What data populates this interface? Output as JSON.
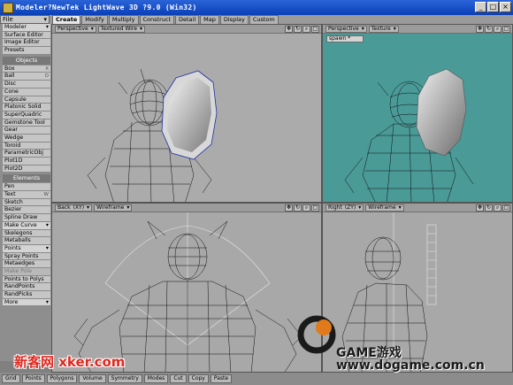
{
  "window": {
    "title": "Modeler?NewTek LightWave 3D ?9.0 (Win32)",
    "buttons": [
      "_",
      "□",
      "×"
    ]
  },
  "toolbar": {
    "file_label": "File",
    "tabs": [
      "Create",
      "Modify",
      "Multiply",
      "Construct",
      "Detail",
      "Map",
      "Display",
      "Custom"
    ],
    "active_tab": "Create"
  },
  "sidebar": {
    "top": [
      {
        "label": "Modeler",
        "dropdown": true
      },
      {
        "label": "Surface Editor",
        "key": ""
      },
      {
        "label": "Image Editor",
        "key": ""
      },
      {
        "label": "Presets",
        "key": ""
      }
    ],
    "objects_header": "Objects",
    "objects": [
      {
        "label": "Box",
        "key": "X"
      },
      {
        "label": "Ball",
        "key": "O"
      },
      {
        "label": "Disc",
        "key": ""
      },
      {
        "label": "Cone",
        "key": ""
      },
      {
        "label": "Capsule",
        "key": ""
      },
      {
        "label": "Platonic Solid",
        "key": ""
      },
      {
        "label": "SuperQuadric",
        "key": ""
      },
      {
        "label": "Gemstone Tool",
        "key": ""
      },
      {
        "label": "Gear",
        "key": ""
      },
      {
        "label": "Wedge",
        "key": ""
      },
      {
        "label": "Toroid",
        "key": ""
      },
      {
        "label": "ParametricObj",
        "key": ""
      },
      {
        "label": "Plot1D",
        "key": ""
      },
      {
        "label": "Plot2D",
        "key": ""
      }
    ],
    "elements_header": "Elements",
    "elements": [
      {
        "label": "Pen",
        "key": ""
      },
      {
        "label": "Text",
        "key": "W"
      },
      {
        "label": "Sketch",
        "key": ""
      },
      {
        "label": "Bezier",
        "key": ""
      },
      {
        "label": "Spline Draw",
        "key": ""
      },
      {
        "label": "Make Curve",
        "key": "",
        "dropdown": true
      },
      {
        "label": "Skelegons",
        "key": ""
      },
      {
        "label": "Metaballs",
        "key": ""
      },
      {
        "label": "Points",
        "key": "",
        "dropdown": true
      },
      {
        "label": "Spray Points",
        "key": ""
      },
      {
        "label": "Metaedges",
        "key": ""
      },
      {
        "label": "Make Pole",
        "key": "",
        "disabled": true
      },
      {
        "label": "Points to Polys",
        "key": ""
      },
      {
        "label": "RandPoints",
        "key": ""
      },
      {
        "label": "RandPicks",
        "key": ""
      },
      {
        "label": "More",
        "key": "",
        "dropdown": true
      }
    ]
  },
  "viewports": {
    "top_left": {
      "view": "Perspective",
      "mode": "Textured Wire"
    },
    "top_right": {
      "view": "Perspective",
      "mode": "Texture",
      "extra": "spawn *"
    },
    "bottom_left": {
      "view": "Back",
      "axis": "(XY)",
      "mode": "Wireframe"
    },
    "bottom_right": {
      "view": "Right",
      "axis": "(ZY)",
      "mode": "Wireframe"
    }
  },
  "bottombar": {
    "items": [
      "Grid",
      "Points",
      "Polygons",
      "Volume",
      "Symmetry",
      "Modes",
      "Cut",
      "Copy",
      "Paste"
    ]
  },
  "watermarks": {
    "xker": "新客网 xker.com",
    "game": "GAME游戏",
    "url": "www.dogame.com.cn"
  },
  "colors": {
    "teal_viewport": "#4a9a98",
    "grey_viewport": "#a8a8a8",
    "title_bar": "#1a4fc8"
  }
}
